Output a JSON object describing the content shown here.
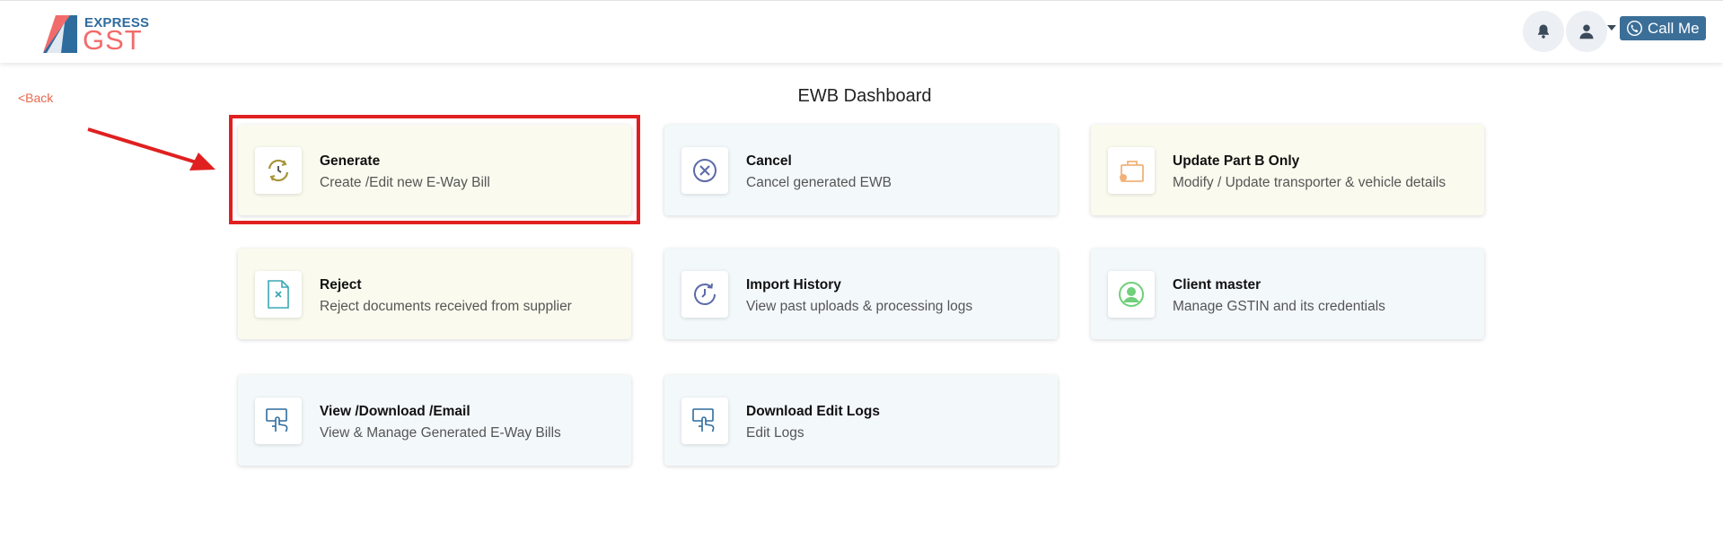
{
  "header": {
    "logo_top": "EXPRESS",
    "logo_bottom": "GST",
    "bell_icon": "bell-icon",
    "user_icon": "user-icon",
    "call_label": "Call Me",
    "call_icon": "phone-icon"
  },
  "back_label": "<Back",
  "page_title": "EWB Dashboard",
  "colors": {
    "brand_blue": "#2f6c9e",
    "brand_red": "#f26b6b",
    "call_button": "#3b6f98",
    "highlight": "#e02020"
  },
  "cards": [
    {
      "title": "Generate",
      "subtitle": "Create /Edit new E-Way Bill",
      "icon": "clock-refresh-icon",
      "tint": "yellow"
    },
    {
      "title": "Cancel",
      "subtitle": "Cancel generated EWB",
      "icon": "cancel-circle-icon",
      "tint": "blue"
    },
    {
      "title": "Update Part B Only",
      "subtitle": "Modify / Update transporter & vehicle details",
      "icon": "briefcase-icon",
      "tint": "yellow"
    },
    {
      "title": "Reject",
      "subtitle": "Reject documents received from supplier",
      "icon": "reject-document-icon",
      "tint": "yellow"
    },
    {
      "title": "Import History",
      "subtitle": "View past uploads & processing logs",
      "icon": "history-icon",
      "tint": "blue"
    },
    {
      "title": "Client master",
      "subtitle": "Manage GSTIN and its credentials",
      "icon": "user-circle-icon",
      "tint": "blue"
    },
    {
      "title": "View /Download /Email",
      "subtitle": "View & Manage Generated E-Way Bills",
      "icon": "touch-screen-icon",
      "tint": "blue"
    },
    {
      "title": "Download Edit Logs",
      "subtitle": "Edit Logs",
      "icon": "touch-screen-icon",
      "tint": "blue"
    }
  ]
}
